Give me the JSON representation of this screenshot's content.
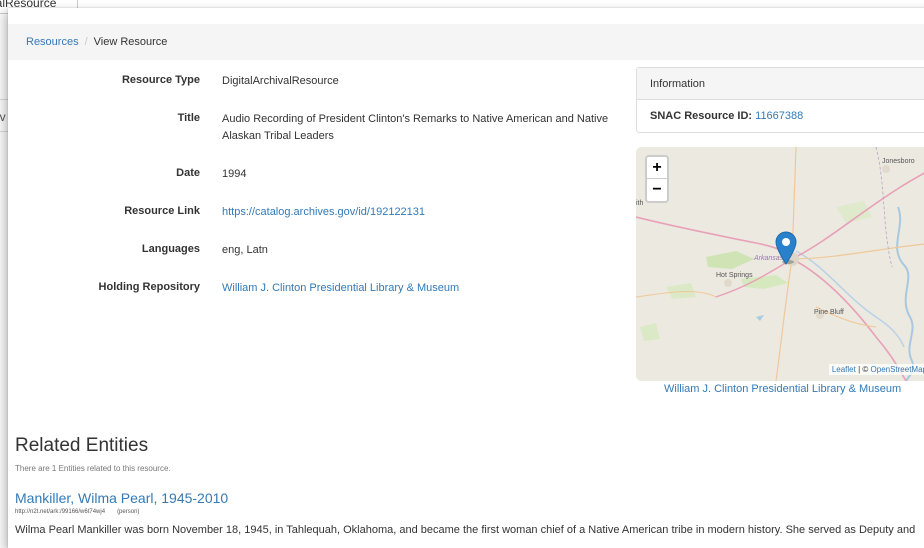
{
  "background": {
    "tab_text": "ivalResource",
    "side_text": "iv"
  },
  "breadcrumb": {
    "root": "Resources",
    "separator": "/",
    "current": "View Resource"
  },
  "fields": [
    {
      "label": "Resource Type",
      "value": "DigitalArchivalResource"
    },
    {
      "label": "Title",
      "value": "Audio Recording of President Clinton's Remarks to Native American and Native Alaskan Tribal Leaders"
    },
    {
      "label": "Date",
      "value": "1994"
    },
    {
      "label": "Resource Link",
      "value": "https://catalog.archives.gov/id/192122131"
    },
    {
      "label": "Languages",
      "value": "eng, Latn"
    },
    {
      "label": "Holding Repository",
      "value": "William J. Clinton Presidential Library & Museum"
    }
  ],
  "info_panel": {
    "heading": "Information",
    "id_label": "SNAC Resource ID:",
    "id_value": "11667388"
  },
  "map": {
    "zoom_in": "+",
    "zoom_out": "−",
    "places": [
      "Jonesboro",
      "Arkansas",
      "Hot Springs",
      "Pine Bluff"
    ],
    "edge_labels": [
      "ith",
      "M"
    ],
    "attribution_leaflet": "Leaflet",
    "attribution_sep": "| ©",
    "attribution_osm": "OpenStreetMap",
    "caption": "William J. Clinton Presidential Library & Museum",
    "marker_color": "#2a81cb"
  },
  "related": {
    "heading": "Related Entities",
    "note": "There are 1 Entities related to this resource.",
    "entity": {
      "name": "Mankiller, Wilma Pearl, 1945-2010",
      "ark": "http://n2t.net/ark:/99166/w6t74wj4",
      "type": "(person)",
      "description": "Wilma Pearl Mankiller was born November 18, 1945, in Tahlequah, Oklahoma, and became the first woman chief of a Native American tribe in modern history. She served as Deputy and"
    }
  },
  "colors": {
    "link": "#337ab7",
    "breadcrumb_bg": "#f5f5f5"
  }
}
